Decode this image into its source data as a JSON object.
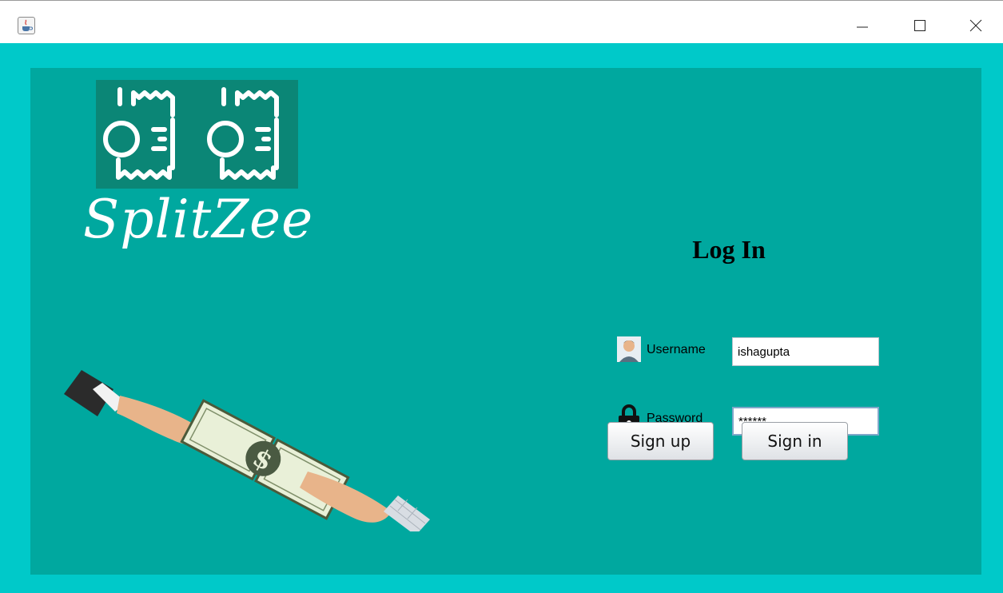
{
  "titlebar": {
    "minimize_icon": "minimize-icon",
    "maximize_icon": "maximize-icon",
    "close_icon": "close-icon"
  },
  "colors": {
    "frame": "#00c9c9",
    "panel": "#00a89f",
    "logo_bg": "#0b8676"
  },
  "brand": {
    "name": "SplitZee"
  },
  "login": {
    "title": "Log In",
    "username_label": "Username",
    "username_value": "ishagupta",
    "password_label": "Password",
    "password_value": "******",
    "signup_label": "Sign up",
    "signin_label": "Sign in"
  }
}
